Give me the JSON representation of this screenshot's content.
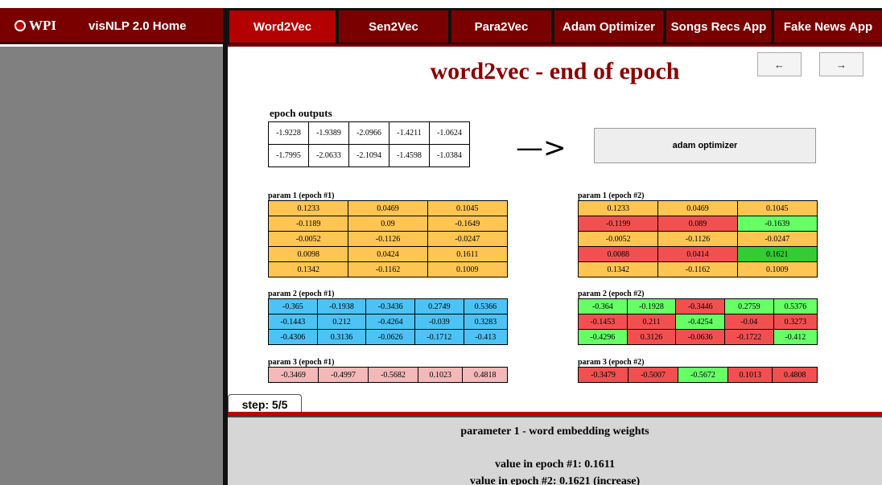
{
  "header": {
    "logo_text": "WPI",
    "home_link": "visNLP 2.0 Home"
  },
  "nav": {
    "tabs": [
      {
        "label": "Word2Vec",
        "active": true
      },
      {
        "label": "Sen2Vec",
        "active": false
      },
      {
        "label": "Para2Vec",
        "active": false
      },
      {
        "label": "Adam Optimizer",
        "active": false
      },
      {
        "label": "Songs Recs App",
        "active": false
      },
      {
        "label": "Fake News App",
        "active": false
      }
    ]
  },
  "main": {
    "title": "word2vec - end of epoch",
    "prev_button": "←",
    "next_button": "→",
    "epoch_outputs": {
      "label": "epoch outputs",
      "rows": [
        [
          "-1.9228",
          "-1.9389",
          "-2.0966",
          "-1.4211",
          "-1.0624"
        ],
        [
          "-1.7995",
          "-2.0633",
          "-2.1094",
          "-1.4598",
          "-1.0384"
        ]
      ]
    },
    "arrow": "—>",
    "adam_button": "adam optimizer",
    "params_epoch1": [
      {
        "label": "param 1 (epoch #1)",
        "rows": [
          [
            "0.1233",
            "0.0469",
            "0.1045"
          ],
          [
            "-0.1189",
            "0.09",
            "-0.1649"
          ],
          [
            "-0.0052",
            "-0.1126",
            "-0.0247"
          ],
          [
            "0.0098",
            "0.0424",
            "0.1611"
          ],
          [
            "0.1342",
            "-0.1162",
            "0.1009"
          ]
        ]
      },
      {
        "label": "param 2 (epoch #1)",
        "rows": [
          [
            "-0.365",
            "-0.1938",
            "-0.3436",
            "0.2749",
            "0.5366"
          ],
          [
            "-0.1443",
            "0.212",
            "-0.4264",
            "-0.039",
            "0.3283"
          ],
          [
            "-0.4306",
            "0.3136",
            "-0.0626",
            "-0.1712",
            "-0.413"
          ]
        ]
      },
      {
        "label": "param 3 (epoch #1)",
        "rows": [
          [
            "-0.3469",
            "-0.4997",
            "-0.5682",
            "0.1023",
            "0.4818"
          ]
        ]
      }
    ],
    "params_epoch2": [
      {
        "label": "param 1 (epoch #2)",
        "rows": [
          [
            "0.1233",
            "0.0469",
            "0.1045"
          ],
          [
            "-0.1199",
            "0.089",
            "-0.1639"
          ],
          [
            "-0.0052",
            "-0.1126",
            "-0.0247"
          ],
          [
            "0.0088",
            "0.0414",
            "0.1621"
          ],
          [
            "0.1342",
            "-0.1162",
            "0.1009"
          ]
        ],
        "colors": [
          [
            "orange",
            "orange",
            "orange"
          ],
          [
            "red",
            "red",
            "green"
          ],
          [
            "orange",
            "orange",
            "orange"
          ],
          [
            "red",
            "red",
            "darkgreen"
          ],
          [
            "orange",
            "orange",
            "orange"
          ]
        ]
      },
      {
        "label": "param 2 (epoch #2)",
        "rows": [
          [
            "-0.364",
            "-0.1928",
            "-0.3446",
            "0.2759",
            "0.5376"
          ],
          [
            "-0.1453",
            "0.211",
            "-0.4254",
            "-0.04",
            "0.3273"
          ],
          [
            "-0.4296",
            "0.3126",
            "-0.0636",
            "-0.1722",
            "-0.412"
          ]
        ],
        "colors": [
          [
            "green",
            "green",
            "red",
            "green",
            "green"
          ],
          [
            "red",
            "red",
            "green",
            "red",
            "red"
          ],
          [
            "green",
            "red",
            "red",
            "red",
            "green"
          ]
        ]
      },
      {
        "label": "param 3 (epoch #2)",
        "rows": [
          [
            "-0.3479",
            "-0.5007",
            "-0.5672",
            "0.1013",
            "0.4808"
          ]
        ],
        "colors": [
          [
            "red",
            "red",
            "green",
            "red",
            "red"
          ]
        ]
      }
    ]
  },
  "step": {
    "label": "step: 5/5"
  },
  "bottom_panel": {
    "title": "parameter 1 - word embedding weights",
    "line1": "value in epoch #1: 0.1611",
    "line2": "value in epoch #2: 0.1621 (increase)"
  },
  "colors": {
    "brand_dark_red": "#7a0000",
    "active_tab_red": "#b30000",
    "title_red": "#8b0000",
    "param1_orange": "#ffc552",
    "param2_blue": "#4dc3f5",
    "param3_pink": "#f5b8b8",
    "increase_green": "#66ff66",
    "increase_dark_green": "#33cc33",
    "decrease_red": "#f25050"
  }
}
